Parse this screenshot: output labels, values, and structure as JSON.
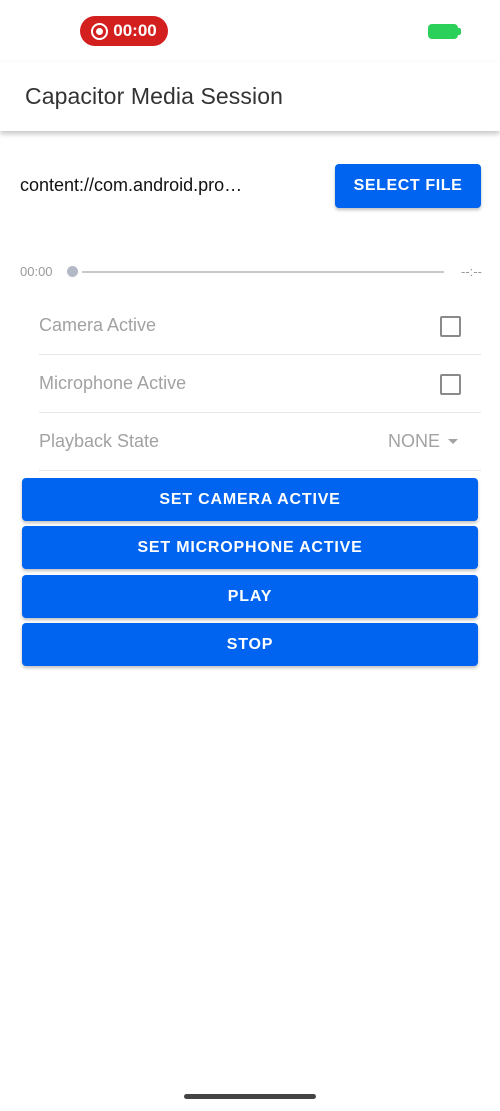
{
  "status_bar": {
    "recording_time": "00:00",
    "recording_color": "#d3201f",
    "battery_color": "#2bd05a"
  },
  "app_bar": {
    "title": "Capacitor Media Session"
  },
  "file": {
    "path": "content://com.android.pro…",
    "select_label": "SELECT FILE"
  },
  "seek": {
    "current_time": "00:00",
    "duration": "--:--",
    "progress": 0
  },
  "list": {
    "camera_label": "Camera Active",
    "camera_checked": false,
    "microphone_label": "Microphone Active",
    "microphone_checked": false,
    "playback_label": "Playback State",
    "playback_value": "NONE"
  },
  "actions": {
    "set_camera": "SET CAMERA ACTIVE",
    "set_microphone": "SET MICROPHONE ACTIVE",
    "play": "PLAY",
    "stop": "STOP"
  },
  "colors": {
    "accent": "#0064f0"
  }
}
